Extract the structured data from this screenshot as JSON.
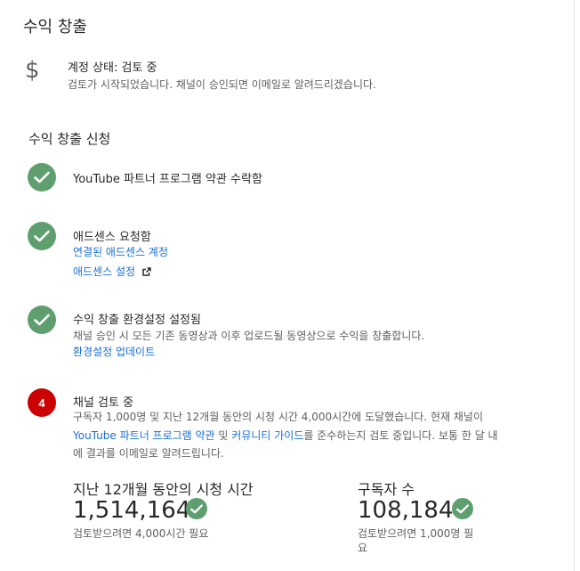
{
  "header": {
    "title": "수익 창출"
  },
  "account_status": {
    "icon": "dollar-icon",
    "heading": "계정 상태: 검토 중",
    "subtext": "검토가 시작되었습니다. 채널이 승인되면 이메일로 알려드리겠습니다."
  },
  "application": {
    "title": "수익 창출 신청",
    "steps": [
      {
        "status": "done",
        "heading": "YouTube 파트너 프로그램 약관 수락함"
      },
      {
        "status": "done",
        "heading": "애드센스 요청함",
        "link1": "연결된 애드센스 계정",
        "link2": "애드센스 설정"
      },
      {
        "status": "done",
        "heading": "수익 창출 환경설정 설정됨",
        "subtext": "채널 승인 시 모든 기존 동영상과 이후 업로드될 동영상으로 수익을 창출합니다.",
        "link": "환경설정 업데이트"
      },
      {
        "status": "in-progress",
        "number": "4",
        "heading": "채널 검토 중",
        "para_a": "구독자 1,000명 및 지난 12개월 동안의 시청 시간 4,000시간에 도달했습니다. 현재",
        "para_b": "채널이 ",
        "link_ypp": "YouTube 파트너 프로그램 약관",
        "para_c": " 및 ",
        "link_community": "커뮤니티 가이드",
        "para_d": "를 준수하는지 검토 중입니다. 보통 한 달 내에 결과를 이메일로 알려드립니다."
      }
    ]
  },
  "stats": {
    "watch_time": {
      "label": "지난 12개월 동안의 시청 시간",
      "value": "1,514,164",
      "note": "검토받으려면 4,000시간 필요"
    },
    "subscribers": {
      "label": "구독자 수",
      "value": "108,184",
      "note_line1": "검토받으려면 1,000명 필",
      "note_line2": "요"
    }
  },
  "colors": {
    "green": "#5f9e6e",
    "red": "#cc0000",
    "link": "#1a6ed8"
  }
}
